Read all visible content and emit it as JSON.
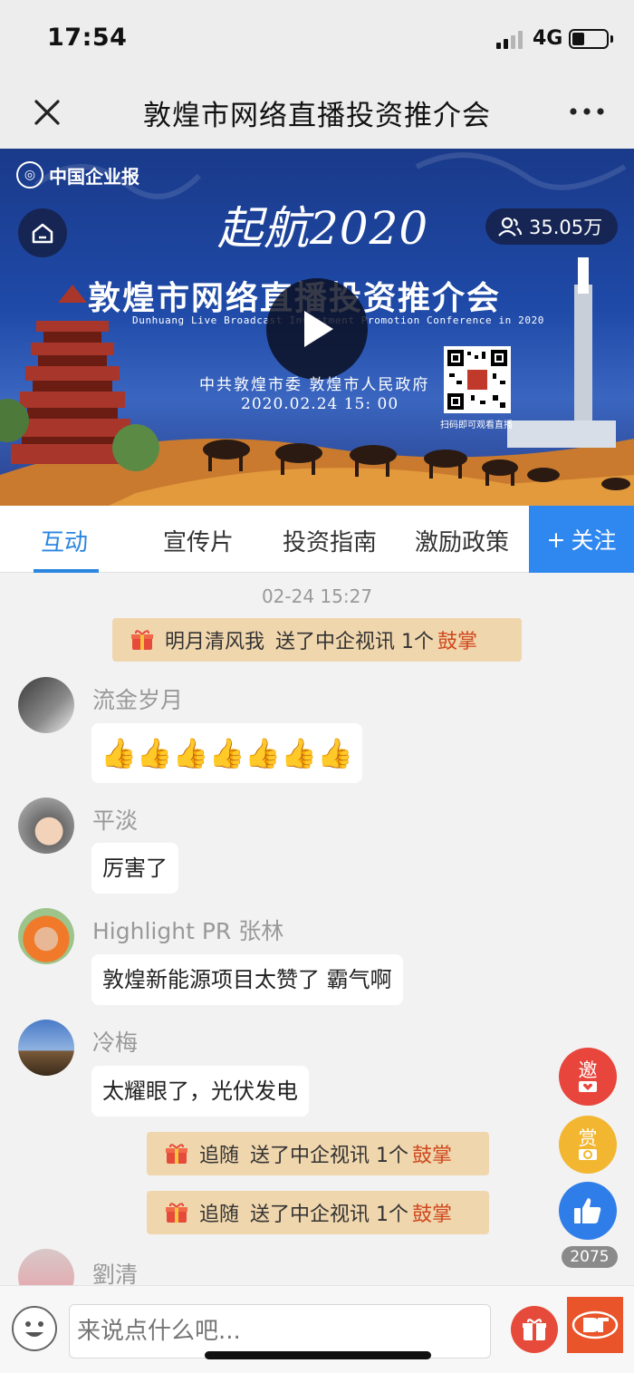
{
  "status_bar": {
    "time": "17:54",
    "network": "4G",
    "battery_level": 0.35
  },
  "nav": {
    "title": "敦煌市网络直播投资推介会",
    "close_icon": "close-icon",
    "more_icon": "more-icon"
  },
  "banner": {
    "logo_text": "中国企业报",
    "slogan": "起航2020",
    "title": "敦煌市网络直播投资推介会",
    "subtitle": "Dunhuang Live  Broadcast  Investment  Promotion Conference  in 2020",
    "organizers": "中共敦煌市委  敦煌市人民政府",
    "datetime": "2020.02.24   15: 00",
    "qr_caption": "扫码即可观看直播",
    "viewer_count": "35.05万"
  },
  "tabs": [
    {
      "label": "互动",
      "active": true
    },
    {
      "label": "宣传片",
      "active": false
    },
    {
      "label": "投资指南",
      "active": false
    },
    {
      "label": "激励政策",
      "active": false
    }
  ],
  "follow_label": "关注",
  "chat": {
    "timestamp": "02-24 15:27",
    "gift_1": {
      "user": "明月清风我",
      "text": "送了中企视讯 1个",
      "gift": "鼓掌"
    },
    "messages": [
      {
        "name": "流金岁月",
        "text": "👍👍👍👍👍👍👍"
      },
      {
        "name": "平淡",
        "text": "厉害了"
      },
      {
        "name": "Highlight PR 张林",
        "text": "敦煌新能源项目太赞了 霸气啊"
      },
      {
        "name": "冷梅",
        "text": "太耀眼了，光伏发电"
      }
    ],
    "gift_2": {
      "user": "追随",
      "text": "送了中企视讯 1个",
      "gift": "鼓掌"
    },
    "gift_3": {
      "user": "追随",
      "text": "送了中企视讯 1个",
      "gift": "鼓掌"
    },
    "partial_name": "劉清"
  },
  "side_buttons": {
    "invite": "邀",
    "reward": "赏",
    "like_count": "2075"
  },
  "input": {
    "placeholder": "来说点什么吧..."
  },
  "colors": {
    "accent_blue": "#2b86e0",
    "follow_bg": "#2f87f0",
    "gift_bar_bg": "#f0d6ad",
    "gift_highlight": "#d0481e",
    "invite_red": "#e8453c",
    "reward_gold": "#f2b630",
    "like_blue": "#2f7de8"
  }
}
